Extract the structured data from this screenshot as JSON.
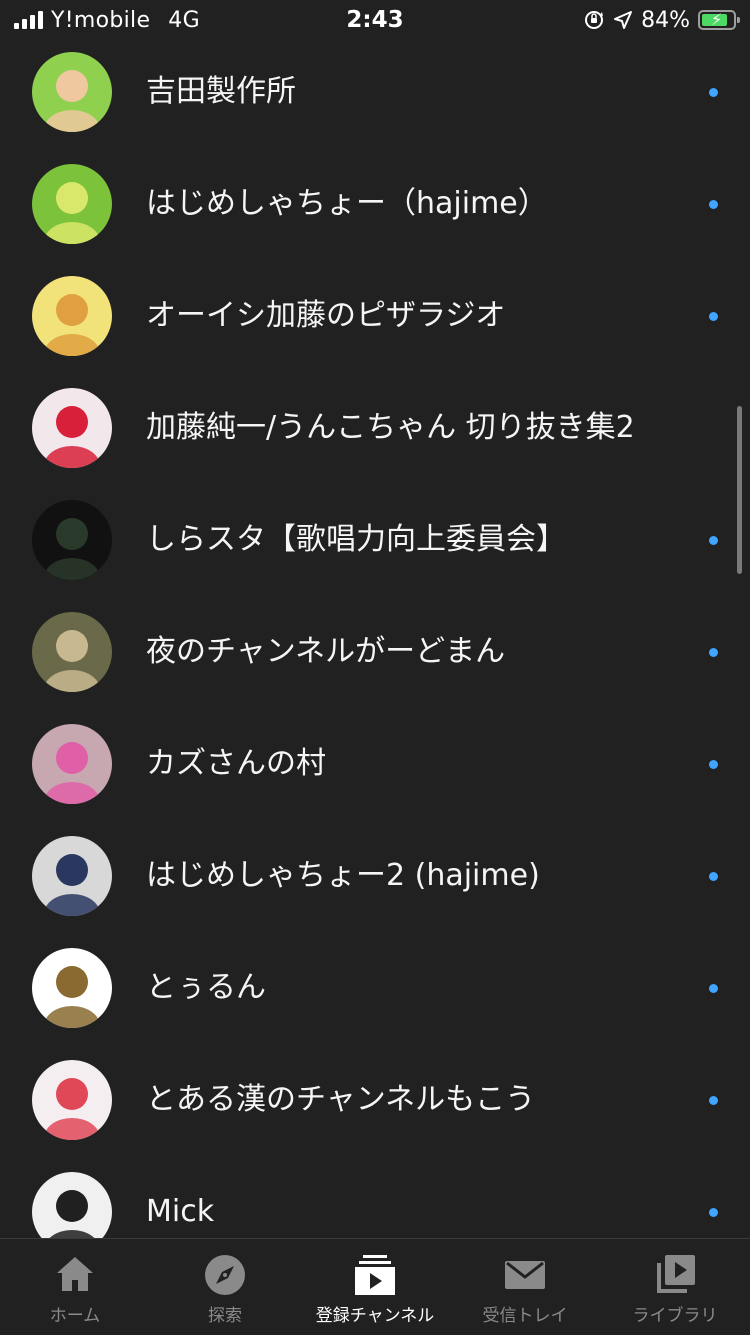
{
  "status_bar": {
    "carrier": "Y!mobile",
    "network": "4G",
    "time": "2:43",
    "battery_percent": "84%",
    "battery_level": 0.84,
    "icons": [
      "signal-icon",
      "orientation-lock-icon",
      "location-arrow-icon",
      "battery-charging-icon"
    ]
  },
  "channels": [
    {
      "name": "吉田製作所",
      "has_new": true,
      "avatar_colors": [
        "#8fd14f",
        "#f0c8a0"
      ]
    },
    {
      "name": "はじめしゃちょー（hajime）",
      "has_new": true,
      "avatar_colors": [
        "#7cc23a",
        "#d9e86a"
      ]
    },
    {
      "name": "オーイシ加藤のピザラジオ",
      "has_new": true,
      "avatar_colors": [
        "#f2e27a",
        "#e0a040"
      ]
    },
    {
      "name": "加藤純一/うんこちゃん 切り抜き集2",
      "has_new": false,
      "avatar_colors": [
        "#f2e8ec",
        "#d8203a"
      ]
    },
    {
      "name": "しらスタ【歌唱力向上委員会】",
      "has_new": true,
      "avatar_colors": [
        "#111111",
        "#2a3a2a"
      ]
    },
    {
      "name": "夜のチャンネルがーどまん",
      "has_new": true,
      "avatar_colors": [
        "#6a6a4a",
        "#c8b890"
      ]
    },
    {
      "name": "カズさんの村",
      "has_new": true,
      "avatar_colors": [
        "#c8a8b0",
        "#e060a8"
      ]
    },
    {
      "name": "はじめしゃちょー2 (hajime)",
      "has_new": true,
      "avatar_colors": [
        "#d8d8d8",
        "#2a3860"
      ]
    },
    {
      "name": "とぅるん",
      "has_new": true,
      "avatar_colors": [
        "#ffffff",
        "#8a6a30"
      ]
    },
    {
      "name": "とある漢のチャンネルもこう",
      "has_new": true,
      "avatar_colors": [
        "#f4eef0",
        "#e04858"
      ]
    },
    {
      "name": "Mick",
      "has_new": true,
      "avatar_colors": [
        "#f0f0f0",
        "#202020"
      ]
    }
  ],
  "tabs": [
    {
      "label": "ホーム",
      "icon": "home-icon",
      "active": false
    },
    {
      "label": "探索",
      "icon": "explore-compass-icon",
      "active": false
    },
    {
      "label": "登録チャンネル",
      "icon": "subscriptions-icon",
      "active": true
    },
    {
      "label": "受信トレイ",
      "icon": "inbox-mail-icon",
      "active": false
    },
    {
      "label": "ライブラリ",
      "icon": "library-icon",
      "active": false
    }
  ],
  "colors": {
    "background": "#212121",
    "new_dot": "#3ea6ff",
    "tab_inactive": "#8a8a8a",
    "tab_active": "#ffffff",
    "battery_fill": "#4cd964"
  }
}
